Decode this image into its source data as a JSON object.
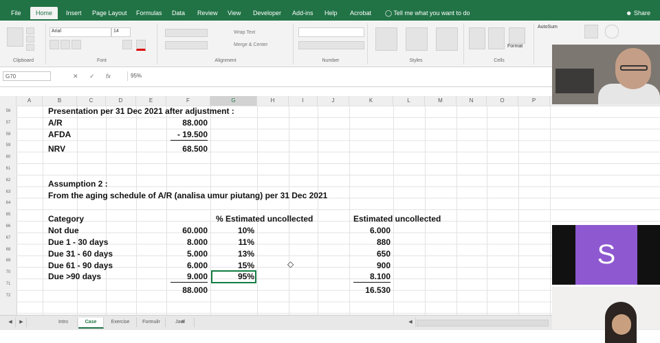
{
  "menubar": {
    "tabs": [
      "File",
      "Home",
      "Insert",
      "Page Layout",
      "Formulas",
      "Data",
      "Review",
      "View",
      "Developer",
      "Add-ins",
      "Help",
      "Acrobat"
    ],
    "tell_me": "Tell me what you want to do",
    "share": "Share"
  },
  "ribbon": {
    "groups": [
      "Clipboard",
      "Font",
      "Alignment",
      "Number",
      "Styles",
      "Cells"
    ],
    "font_name": "Arial",
    "font_size": "14",
    "wrap_text": "Wrap Text",
    "merge_center": "Merge & Center",
    "format": "Format",
    "autosum": "AutoSum"
  },
  "formula_bar": {
    "name_box": "G70",
    "formula": "95%"
  },
  "columns": [
    "A",
    "B",
    "C",
    "D",
    "E",
    "F",
    "G",
    "H",
    "I",
    "J",
    "K",
    "L",
    "M",
    "N",
    "O",
    "P"
  ],
  "rows": [
    "56",
    "57",
    "58",
    "59",
    "60",
    "61",
    "62",
    "63",
    "64",
    "65",
    "66",
    "67",
    "68",
    "69",
    "70",
    "71",
    "72"
  ],
  "sheet": {
    "presentation_title": "Presentation per 31 Dec 2021 after adjustment :",
    "ar_label": "A/R",
    "ar_value": "88.000",
    "afda_label": "AFDA",
    "afda_value": "-  19.500",
    "nrv_label": "NRV",
    "nrv_value": "68.500",
    "assumption": "Assumption  2 :",
    "aging_line": "From the aging schedule of A/R (analisa umur piutang) per 31 Dec 2021",
    "hdr_category": "Category",
    "hdr_pct": "% Estimated uncollected",
    "hdr_est": "Estimated uncollected",
    "categories": [
      "Not due",
      "Due 1 - 30 days",
      "Due 31 - 60 days",
      "Due 61 - 90 days",
      "Due >90 days"
    ],
    "amounts": [
      "60.000",
      "8.000",
      "5.000",
      "6.000",
      "9.000"
    ],
    "pcts": [
      "10%",
      "11%",
      "13%",
      "15%",
      "95%"
    ],
    "estimates": [
      "6.000",
      "880",
      "650",
      "900",
      "8.100"
    ],
    "total_amount": "88.000",
    "total_est": "16.530"
  },
  "sheet_tabs": [
    "Intro",
    "Case",
    "Exercise",
    "Formulir",
    "Jawl"
  ],
  "participant": {
    "initial": "S",
    "tile_color": "#8e58d0"
  }
}
